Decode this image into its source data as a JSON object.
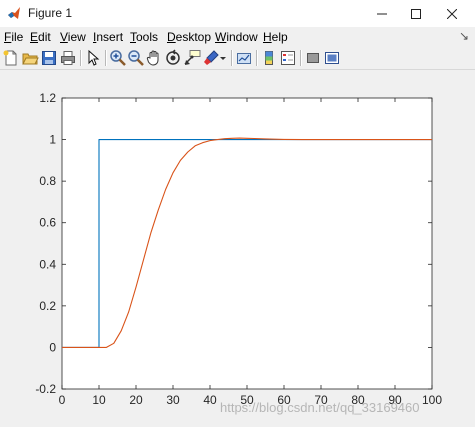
{
  "window": {
    "title": "Figure 1",
    "minimize_icon": "minimize-icon",
    "maximize_icon": "maximize-icon",
    "close_icon": "close-icon"
  },
  "menu": {
    "items": [
      {
        "label": "File",
        "accel": "F"
      },
      {
        "label": "Edit",
        "accel": "E"
      },
      {
        "label": "View",
        "accel": "V"
      },
      {
        "label": "Insert",
        "accel": "I"
      },
      {
        "label": "Tools",
        "accel": "T"
      },
      {
        "label": "Desktop",
        "accel": "D"
      },
      {
        "label": "Window",
        "accel": "W"
      },
      {
        "label": "Help",
        "accel": "H"
      }
    ]
  },
  "toolbar": {
    "icons": [
      "new-figure-icon",
      "open-file-icon",
      "save-icon",
      "print-icon",
      "edit-plot-arrow-icon",
      "zoom-in-icon",
      "zoom-out-icon",
      "pan-hand-icon",
      "rotate-3d-icon",
      "data-cursor-icon",
      "brush-icon",
      "brush-dropdown-icon",
      "link-plot-icon",
      "insert-colorbar-icon",
      "insert-legend-icon",
      "hide-plot-tools-icon",
      "show-plot-tools-icon"
    ]
  },
  "colors": {
    "axes_background": "#ffffff",
    "figure_background": "#f0f0f0",
    "series_1": "#0072bd",
    "series_2": "#d95319"
  },
  "watermark": "https://blog.csdn.net/qq_33169460",
  "chart_data": {
    "type": "line",
    "title": "",
    "xlabel": "",
    "ylabel": "",
    "xlim": [
      0,
      100
    ],
    "ylim": [
      -0.2,
      1.2
    ],
    "xticks": [
      0,
      10,
      20,
      30,
      40,
      50,
      60,
      70,
      80,
      90,
      100
    ],
    "yticks": [
      -0.2,
      0,
      0.2,
      0.4,
      0.6,
      0.8,
      1,
      1.2
    ],
    "yticklabels": [
      "-0.2",
      "0",
      "0.2",
      "0.4",
      "0.6",
      "0.8",
      "1",
      "1.2"
    ],
    "grid": false,
    "legend": false,
    "series": [
      {
        "color": "#0072bd",
        "x": [
          0,
          10,
          10,
          100
        ],
        "y": [
          0,
          0,
          1,
          1
        ]
      },
      {
        "color": "#d95319",
        "x": [
          0,
          12,
          14,
          16,
          18,
          20,
          22,
          24,
          26,
          28,
          30,
          32,
          34,
          36,
          38,
          40,
          42,
          44,
          46,
          48,
          50,
          52,
          55,
          60,
          65,
          70,
          80,
          90,
          100
        ],
        "y": [
          0,
          0,
          0.02,
          0.08,
          0.17,
          0.29,
          0.42,
          0.55,
          0.66,
          0.76,
          0.84,
          0.9,
          0.94,
          0.97,
          0.985,
          0.995,
          1.0,
          1.004,
          1.006,
          1.007,
          1.006,
          1.005,
          1.003,
          1.001,
          1.0,
          1.0,
          1.0,
          1.0,
          1.0
        ]
      }
    ]
  }
}
